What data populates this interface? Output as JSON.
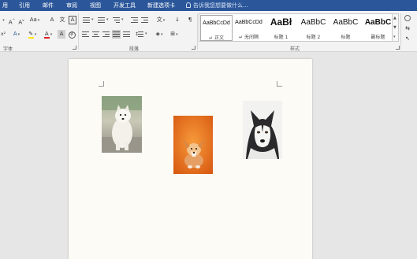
{
  "menu": {
    "tabs": [
      "用",
      "引用",
      "邮件",
      "审阅",
      "视图",
      "开发工具",
      "新建选项卡"
    ],
    "tell_me": "告诉我您想要做什么..."
  },
  "ribbon": {
    "font_group_label": "字体",
    "paragraph_group_label": "段落",
    "styles_group_label": "样式",
    "styles": [
      {
        "preview": "AaBbCcDd",
        "name": "↵ 正文",
        "selected": true
      },
      {
        "preview": "AaBbCcDd",
        "name": "↵ 无间隔",
        "selected": false
      },
      {
        "preview": "AaBł",
        "name": "标题 1",
        "selected": false
      },
      {
        "preview": "AaBbC",
        "name": "标题 2",
        "selected": false
      },
      {
        "preview": "AaBbC",
        "name": "标题",
        "selected": false
      },
      {
        "preview": "AaBbC",
        "name": "副标题",
        "selected": false
      }
    ],
    "colors": {
      "highlight": "#ffe600",
      "font_color": "#e02020",
      "menu_bg": "#2b579a"
    }
  },
  "document": {
    "images": [
      {
        "subject": "white samoyed dog photo",
        "icon": "samoyed-photo"
      },
      {
        "subject": "corgi puppy on orange background",
        "icon": "corgi-photo"
      },
      {
        "subject": "husky dog portrait",
        "icon": "husky-photo"
      }
    ]
  }
}
